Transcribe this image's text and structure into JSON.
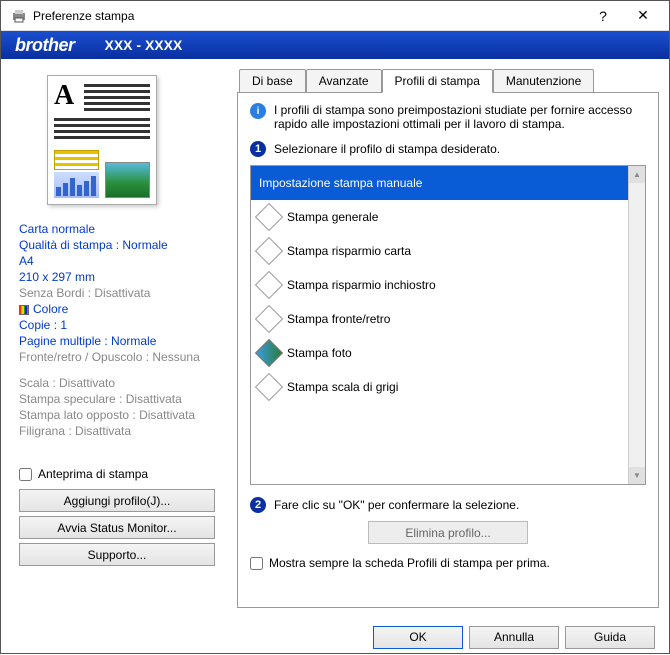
{
  "window": {
    "title": "Preferenze stampa"
  },
  "brand": {
    "name": "brother",
    "model": "XXX - XXXX"
  },
  "preview_settings": {
    "paper": "Carta normale",
    "quality": "Qualità di stampa : Normale",
    "size_name": "A4",
    "size_dim": "210 x 297 mm",
    "borderless": "Senza Bordi : Disattivata",
    "color": "Colore",
    "copies": "Copie : 1",
    "multi": "Pagine multiple : Normale",
    "duplex": "Fronte/retro / Opuscolo : Nessuna",
    "scale": "Scala : Disattivato",
    "mirror": "Stampa speculare : Disattivata",
    "reverse": "Stampa lato opposto : Disattivata",
    "watermark": "Filigrana : Disattivata"
  },
  "left_buttons": {
    "preview_check": "Anteprima di stampa",
    "add_profile": "Aggiungi profilo(J)...",
    "status_monitor": "Avvia Status Monitor...",
    "support": "Supporto..."
  },
  "tabs": [
    "Di base",
    "Avanzate",
    "Profili di stampa",
    "Manutenzione"
  ],
  "content": {
    "info_text": "I profili di stampa sono preimpostazioni studiate per fornire accesso rapido alle impostazioni ottimali per il lavoro di stampa.",
    "step1": "Selezionare il profilo di stampa desiderato.",
    "step2": "Fare clic su \"OK\" per confermare la selezione.",
    "delete_btn": "Elimina profilo...",
    "always_show": "Mostra sempre la scheda Profili di stampa per prima."
  },
  "profiles": [
    {
      "label": "Impostazione stampa manuale",
      "selected": true
    },
    {
      "label": "Stampa generale"
    },
    {
      "label": "Stampa risparmio carta"
    },
    {
      "label": "Stampa risparmio inchiostro"
    },
    {
      "label": "Stampa fronte/retro"
    },
    {
      "label": "Stampa foto",
      "photo": true
    },
    {
      "label": "Stampa scala di grigi"
    }
  ],
  "dialog_buttons": {
    "ok": "OK",
    "cancel": "Annulla",
    "help": "Guida"
  }
}
